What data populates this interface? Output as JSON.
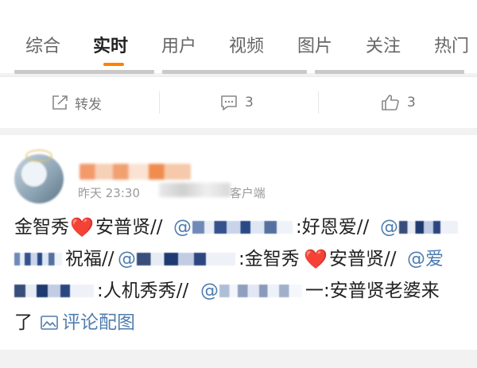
{
  "tabs": [
    {
      "label": "综合",
      "active": false
    },
    {
      "label": "实时",
      "active": true
    },
    {
      "label": "用户",
      "active": false
    },
    {
      "label": "视频",
      "active": false
    },
    {
      "label": "图片",
      "active": false
    },
    {
      "label": "关注",
      "active": false
    },
    {
      "label": "热门",
      "active": false
    }
  ],
  "accent_color": "#ff8200",
  "link_color": "#507daf",
  "prev_post_actions": {
    "repost_label": "转发",
    "comment_count": "3",
    "like_count": "3",
    "repost_icon": "share-arrow-icon",
    "comment_icon": "comment-bubble-icon",
    "like_icon": "thumbs-up-icon"
  },
  "post": {
    "time_partial": "昨天 23:30",
    "source_partial": "客户端",
    "content": {
      "l1_a": "金智秀",
      "l1_heart": "❤️",
      "l1_b": "安普贤//",
      "l1_at1": "@",
      "l1_c": ":好恩爱//",
      "l1_at2": "@",
      "l2_a": "祝福//",
      "l2_at": "@",
      "l2_b": ":金智秀",
      "l2_heart": "❤️",
      "l2_c": "安普贤//",
      "l2_at2": "@爱",
      "l3_a": ":人机秀秀//",
      "l3_at": "@",
      "l3_b": "一:安普贤老婆来",
      "l4_a": "了",
      "comment_pic_label": "评论配图",
      "comment_pic_icon": "image-icon"
    }
  }
}
